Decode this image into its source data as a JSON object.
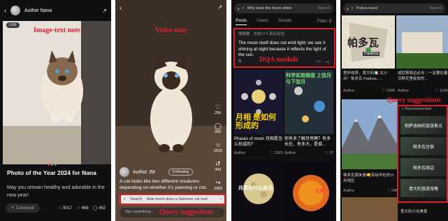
{
  "labels": {
    "image_text_note": "Image-text note",
    "video_note": "Video note",
    "dqa_module": "DQA module",
    "query_suggestions_1": "Query suggestions",
    "query_suggestions_2": "Query suggestions"
  },
  "panel1": {
    "author": "Author Nana",
    "live_badge": "LIVE",
    "title": "Photo of the Year 2024 for Nana",
    "description": "May you remain healthy and adorable in the new year!",
    "comment_label": "Comment",
    "likes": "9017",
    "stars": "668",
    "comments": "462"
  },
  "panel2": {
    "author": "Author JM",
    "follow_label": "Following",
    "caption": "A cat looks like two different creatures depending on whether it's yawning or not.",
    "search_label": "Search",
    "search_query": "How much does a Siamese cat cost",
    "say_placeholder": "Say something...",
    "counts": [
      "25K",
      "950",
      "2523",
      "442",
      "3383"
    ]
  },
  "panel3": {
    "search_text": "Why does the moon shine",
    "search_button": "Search",
    "tabs": [
      "Posts",
      "Users",
      "Goods"
    ],
    "filter_label": "Filter",
    "answer_header": "搜搜薯 · 总结17人真实经验",
    "answer_text": "The moon itself does not emit light; we see it shining at night because it reflects the light of the sun.",
    "card1_headline": "科学实验频道 上弦月与下弦月",
    "card1_overlay": "月相 是如何形成的",
    "card1_title": "Phases of moon 月相是怎么形成的？",
    "card1_author": "Author",
    "card1_likes": "1301",
    "card2_title": "你有多了解月亮啊？有多长在，有多大，是谁...",
    "card2_author": "Author",
    "card2_likes": "37",
    "card3_overlay": "月亮为什么发光",
    "card4_overlay": "太阳"
  },
  "panel4": {
    "search_text": "Padua travel",
    "search_button": "Search",
    "card1_overlay": "帕多瓦",
    "card1_sublabel": "Padova",
    "card1_title": "意外收获，意大利🇮🇹 太小众！帕多瓦 Padova, ...",
    "card1_author": "Author",
    "card1_likes": "1288",
    "card2_title": "成尼斯周边必去｜一定要在春日鲜花里绽放的...",
    "card2_author": "Author",
    "card2_likes": "1245",
    "recommended_header": "Recommended",
    "recommended_items": [
      "帕萨迪纳的旅游景点",
      "帕多瓦住宿",
      "帕多瓦周边",
      "意大利旅游攻略"
    ],
    "card3_title": "帕多瓦周末游👊有坛中在的小众地区",
    "card3_author": "Author",
    "card3_likes": "245",
    "card4_title": "意大利小众美景"
  },
  "colors": {
    "annotation_red": "#e0202a"
  }
}
